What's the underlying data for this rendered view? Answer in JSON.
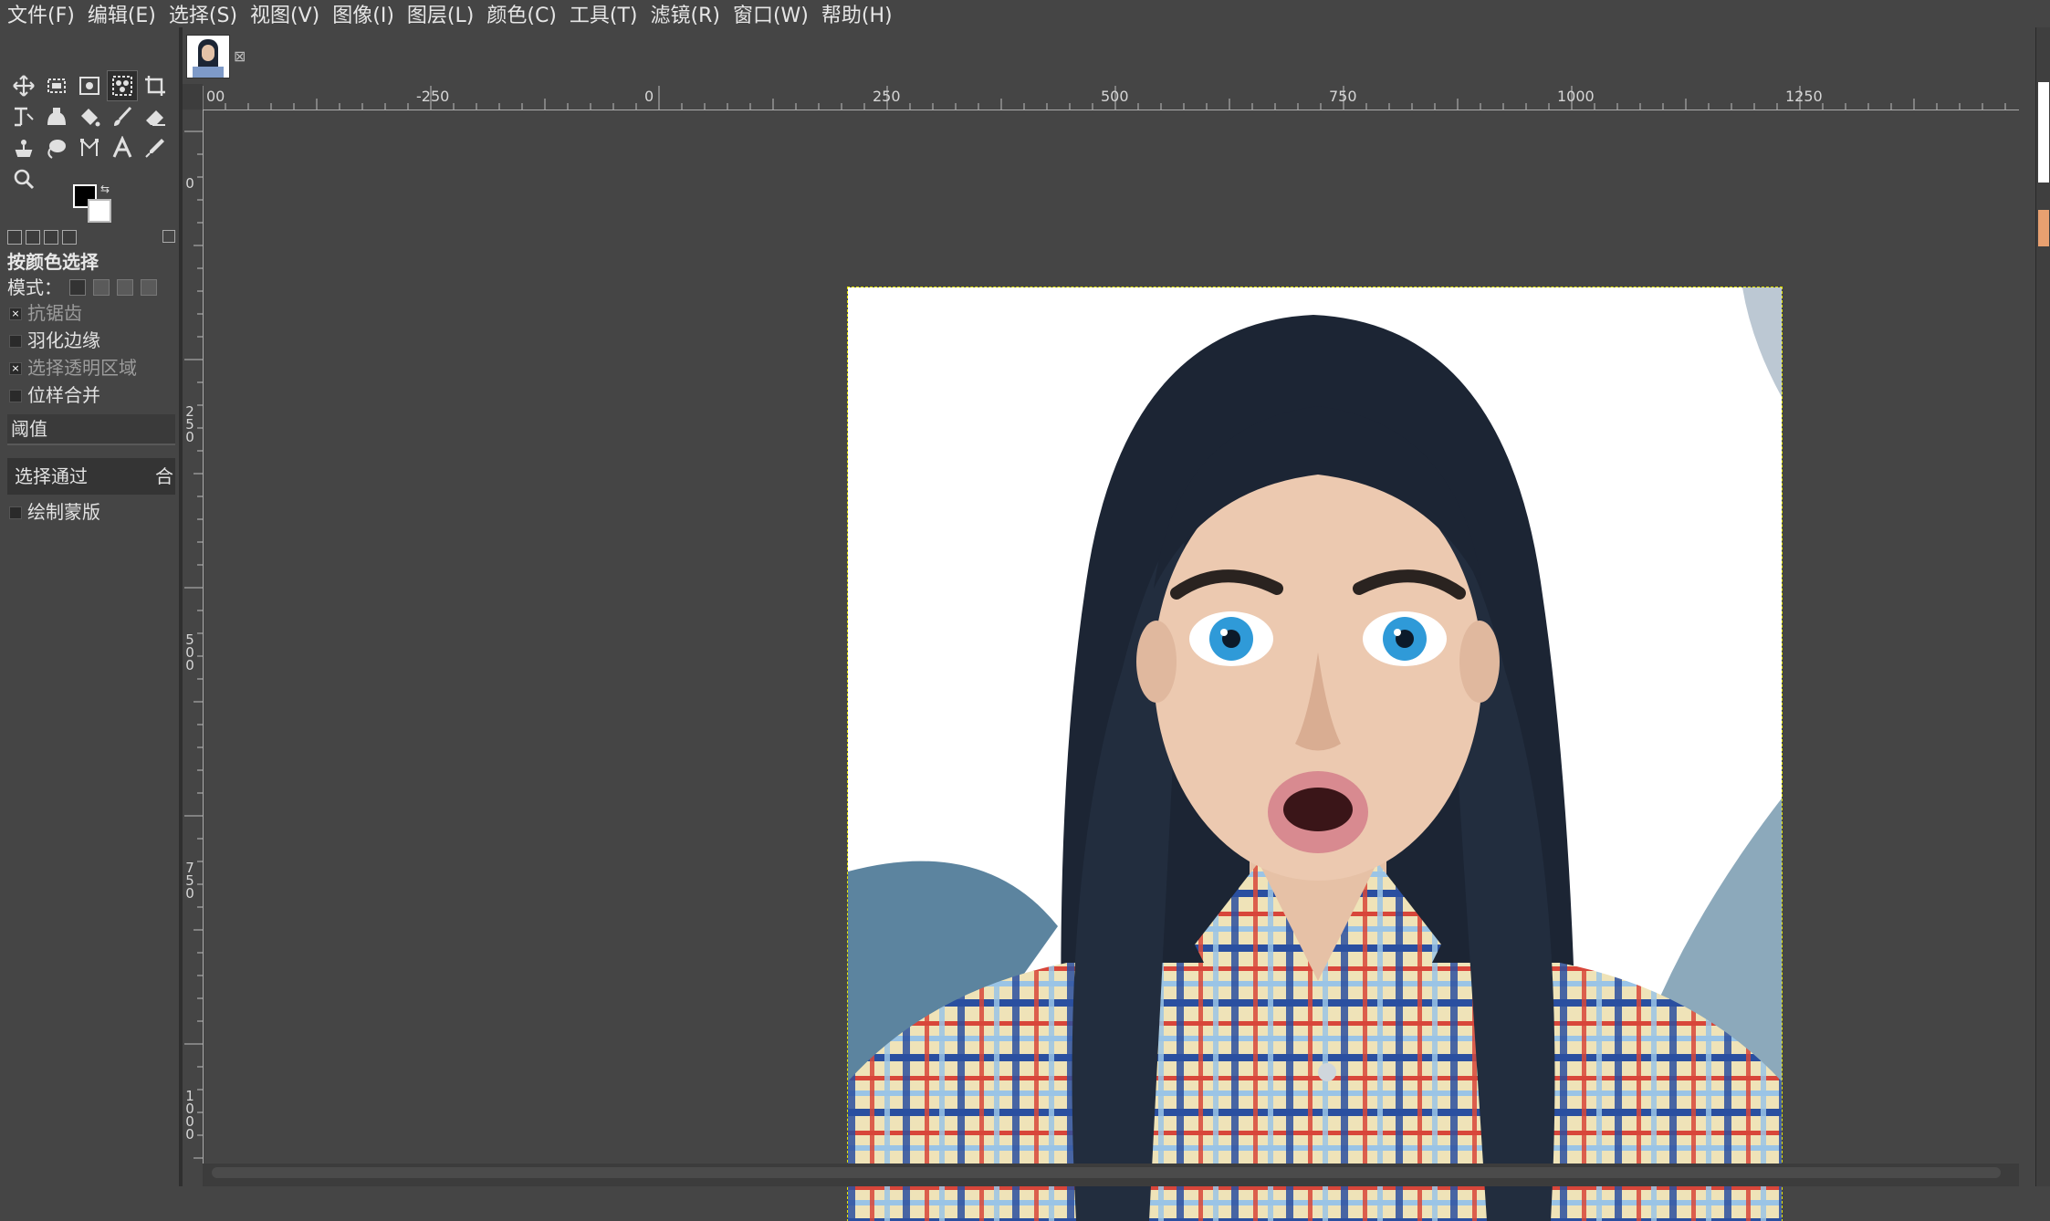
{
  "menubar": {
    "items": [
      "文件(F)",
      "编辑(E)",
      "选择(S)",
      "视图(V)",
      "图像(I)",
      "图层(L)",
      "颜色(C)",
      "工具(T)",
      "滤镜(R)",
      "窗口(W)",
      "帮助(H)"
    ]
  },
  "toolbox": {
    "tools": [
      "move-tool-icon",
      "rect-select-icon",
      "align-tool-icon",
      "select-by-color-icon",
      "crop-icon",
      "transform-icon",
      "warp-icon",
      "bucket-fill-icon",
      "paintbrush-icon",
      "eraser-icon",
      "clone-icon",
      "smudge-icon",
      "paths-icon",
      "text-icon",
      "color-picker-icon",
      "zoom-icon"
    ],
    "foreground_color": "#000000",
    "background_color": "#ffffff"
  },
  "tool_options": {
    "title": "按颜色选择",
    "mode_label": "模式：",
    "antialias": {
      "label": "抗锯齿",
      "checked": true,
      "enabled": false
    },
    "feather": {
      "label": "羽化边缘",
      "checked": false,
      "enabled": true
    },
    "select_transparent": {
      "label": "选择透明区域",
      "checked": true,
      "enabled": false
    },
    "sample_merged": {
      "label": "位样合并",
      "checked": false,
      "enabled": true
    },
    "threshold_label": "阈值",
    "select_by_label": "选择通过",
    "select_by_value_partial": "合",
    "draw_mask": {
      "label": "绘制蒙版",
      "checked": false,
      "enabled": true
    }
  },
  "rulers": {
    "horizontal_labels": [
      "00",
      "-250",
      "0",
      "250",
      "500",
      "750",
      "1000",
      "1250"
    ],
    "vertical_labels": [
      "0",
      "250",
      "500",
      "750",
      "1000"
    ]
  },
  "image": {
    "description_icon": "portrait-image"
  }
}
